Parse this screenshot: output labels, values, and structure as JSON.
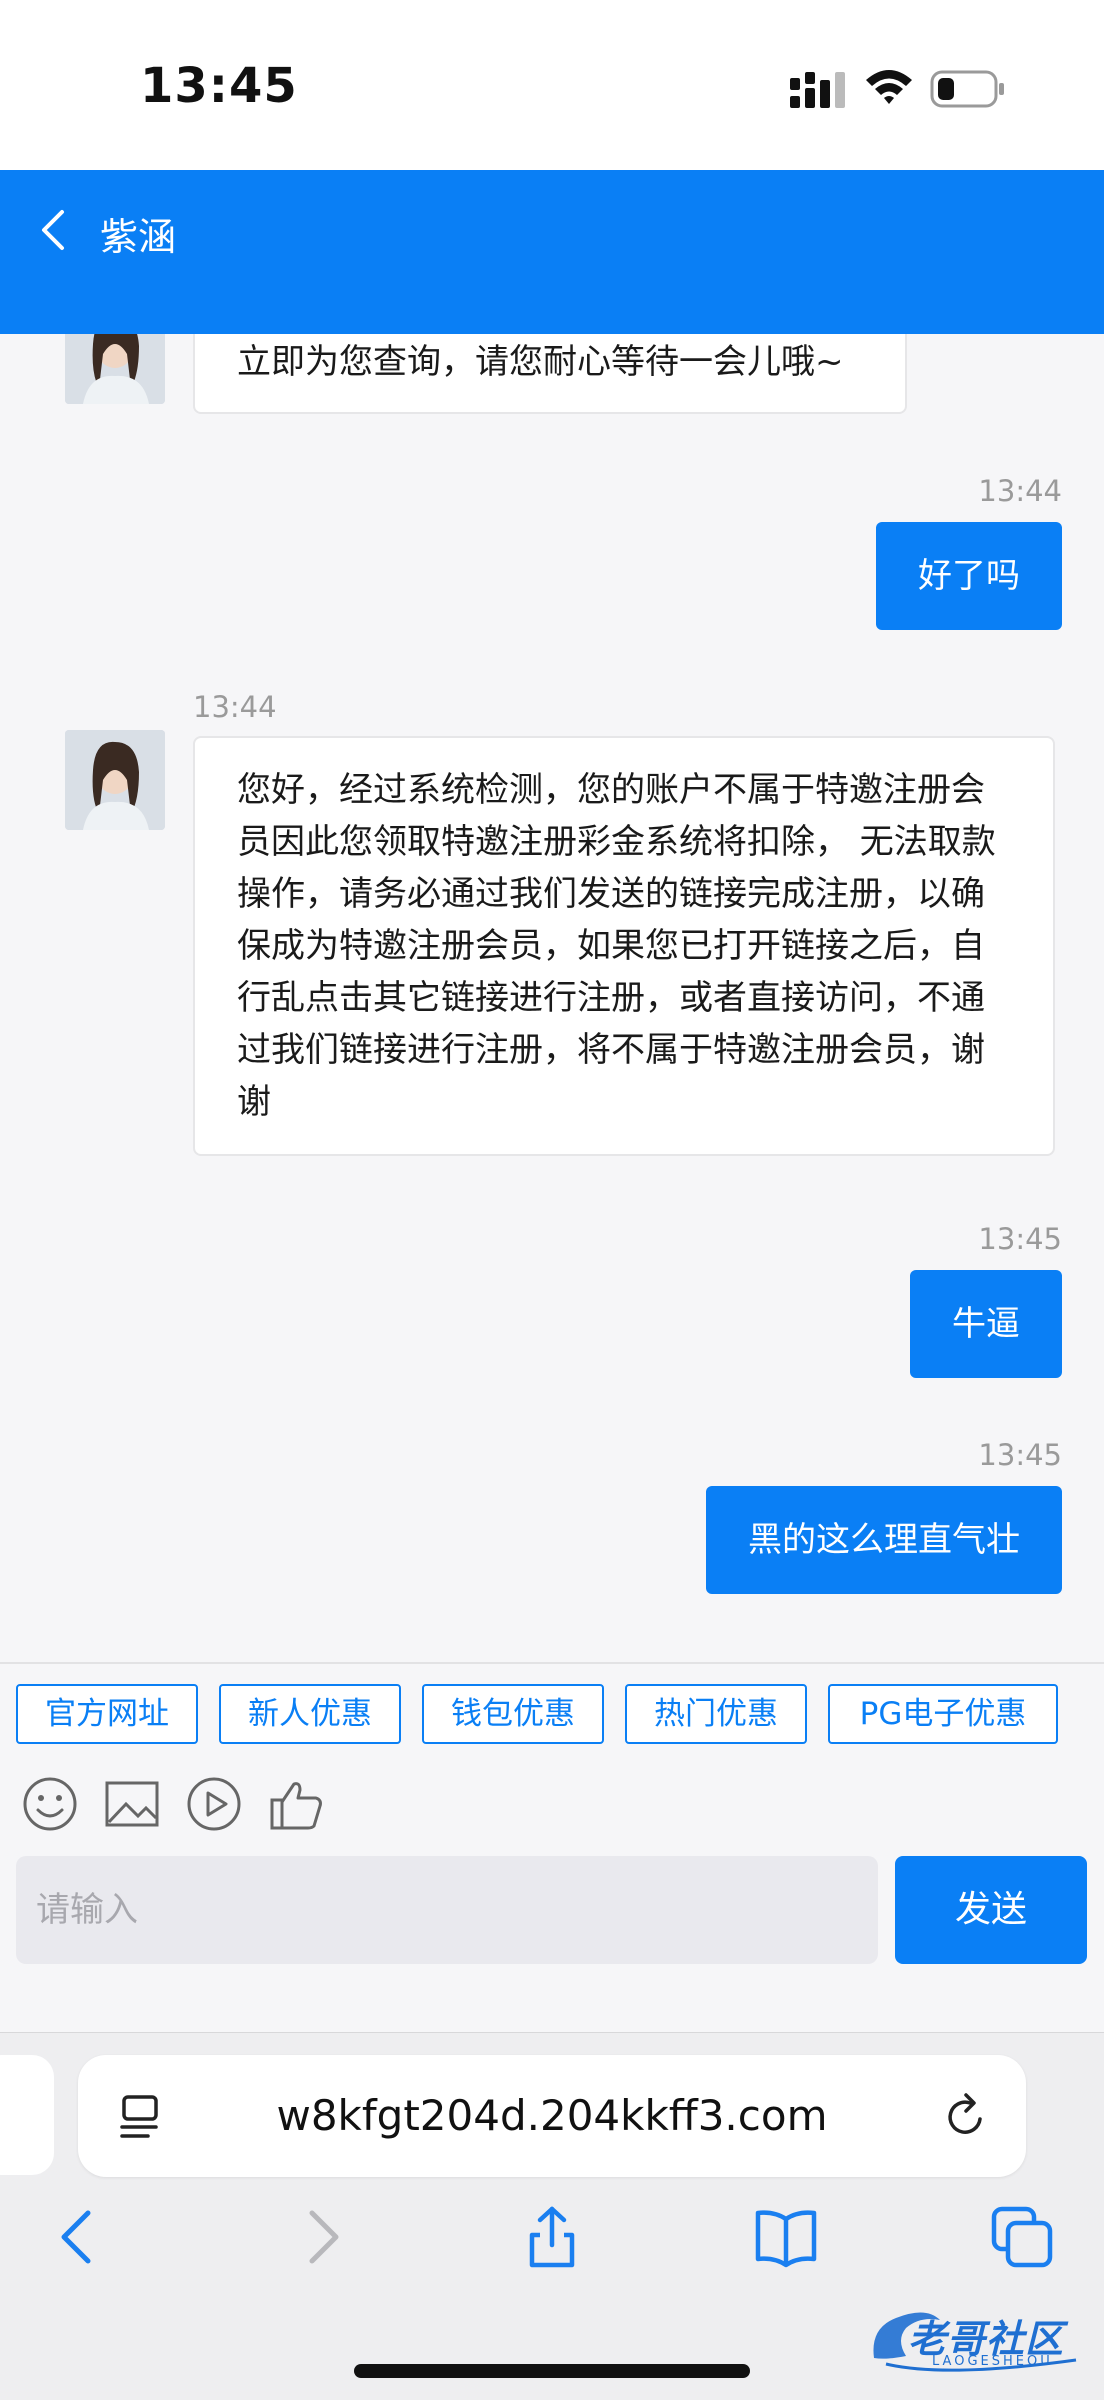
{
  "status_bar": {
    "time": "13:45"
  },
  "header": {
    "contact_name": "紫涵"
  },
  "messages": [
    {
      "dir": "in",
      "text": "立即为您查询，请您耐心等待一会儿哦~"
    },
    {
      "dir": "out",
      "time": "13:44",
      "text": "好了吗"
    },
    {
      "dir": "in",
      "time": "13:44",
      "text": "您好，经过系统检测，您的账户不属于特邀注册会员因此您领取特邀注册彩金系统将扣除， 无法取款操作，请务必通过我们发送的链接完成注册，以确保成为特邀注册会员，如果您已打开链接之后，自行乱点击其它链接进行注册，或者直接访问，不通过我们链接进行注册，将不属于特邀注册会员，谢谢"
    },
    {
      "dir": "out",
      "time": "13:45",
      "text": "牛逼"
    },
    {
      "dir": "out",
      "time": "13:45",
      "text": "黑的这么理直气壮"
    }
  ],
  "quick_links": [
    "官方网址",
    "新人优惠",
    "钱包优惠",
    "热门优惠",
    "PG电子优惠"
  ],
  "toolbar_icons": [
    "emoji-icon",
    "image-icon",
    "video-icon",
    "thumbs-up-icon"
  ],
  "composer": {
    "placeholder": "请输入",
    "send_label": "发送"
  },
  "browser": {
    "url": "w8kfgt204d.204kkff3.com"
  },
  "watermark": {
    "text": "老哥社区",
    "sub": "LAOGESHEQU"
  },
  "colors": {
    "accent": "#0a7ff5",
    "bubble_in": "#ffffff",
    "background": "#f6f6f8"
  }
}
